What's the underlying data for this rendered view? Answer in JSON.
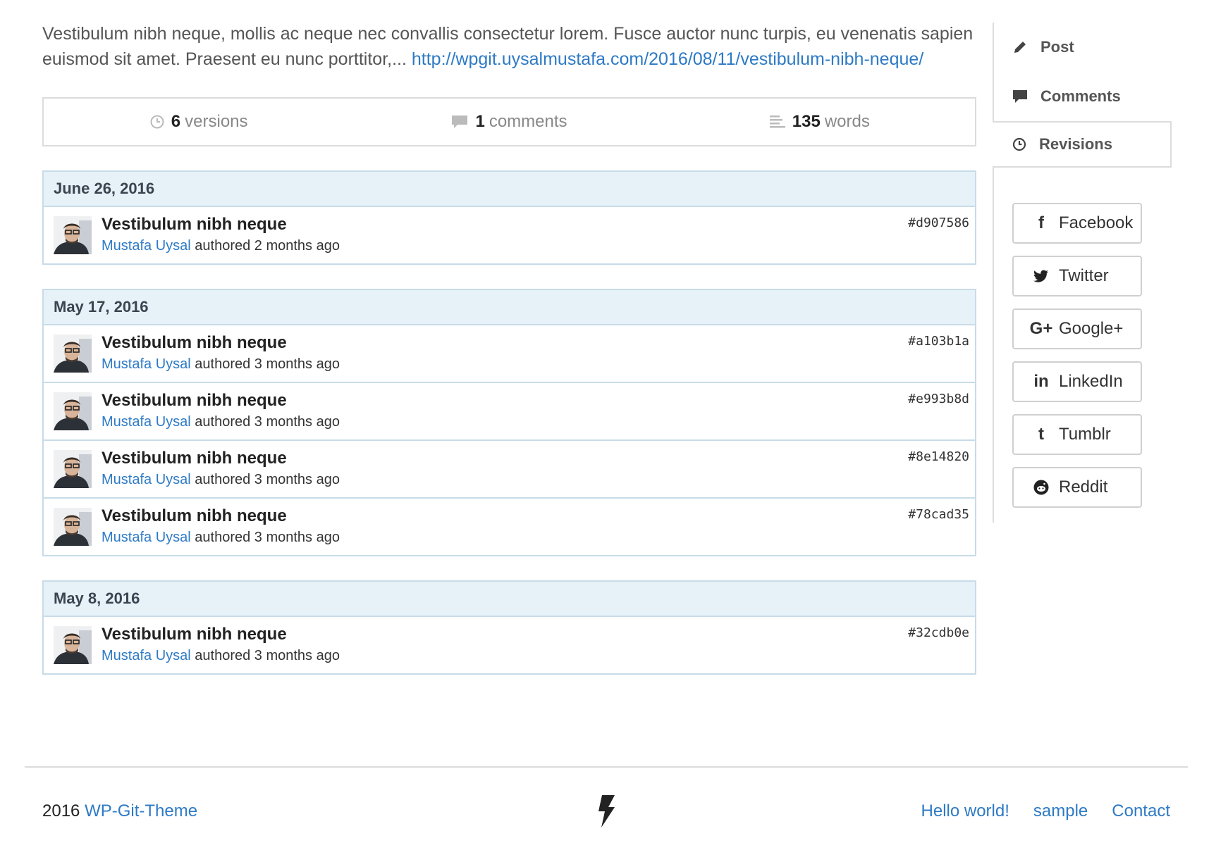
{
  "excerpt": {
    "text": "Vestibulum nibh neque, mollis ac neque nec convallis consectetur lorem. Fusce auctor nunc turpis, eu venenatis sapien euismod sit amet. Praesent eu nunc porttitor,...",
    "link": "http://wpgit.uysalmustafa.com/2016/08/11/vestibulum-nibh-neque/"
  },
  "stats": {
    "versions_count": "6",
    "versions_label": "versions",
    "comments_count": "1",
    "comments_label": "comments",
    "words_count": "135",
    "words_label": "words"
  },
  "groups": [
    {
      "date": "June 26, 2016",
      "commits": [
        {
          "title": "Vestibulum nibh neque",
          "author": "Mustafa Uysal",
          "action": "authored 2 months ago",
          "hash": "#d907586"
        }
      ]
    },
    {
      "date": "May 17, 2016",
      "commits": [
        {
          "title": "Vestibulum nibh neque",
          "author": "Mustafa Uysal",
          "action": "authored 3 months ago",
          "hash": "#a103b1a"
        },
        {
          "title": "Vestibulum nibh neque",
          "author": "Mustafa Uysal",
          "action": "authored 3 months ago",
          "hash": "#e993b8d"
        },
        {
          "title": "Vestibulum nibh neque",
          "author": "Mustafa Uysal",
          "action": "authored 3 months ago",
          "hash": "#8e14820"
        },
        {
          "title": "Vestibulum nibh neque",
          "author": "Mustafa Uysal",
          "action": "authored 3 months ago",
          "hash": "#78cad35"
        }
      ]
    },
    {
      "date": "May 8, 2016",
      "commits": [
        {
          "title": "Vestibulum nibh neque",
          "author": "Mustafa Uysal",
          "action": "authored 3 months ago",
          "hash": "#32cdb0e"
        }
      ]
    }
  ],
  "sidebar": {
    "nav": [
      {
        "label": "Post",
        "icon": "pencil-icon"
      },
      {
        "label": "Comments",
        "icon": "comment-icon"
      },
      {
        "label": "Revisions",
        "icon": "clock-icon",
        "active": true
      }
    ],
    "share": [
      {
        "label": "Facebook",
        "icon": "facebook-icon",
        "glyph": "f"
      },
      {
        "label": "Twitter",
        "icon": "twitter-icon",
        "glyph": ""
      },
      {
        "label": "Google+",
        "icon": "google-plus-icon",
        "glyph": "G+"
      },
      {
        "label": "LinkedIn",
        "icon": "linkedin-icon",
        "glyph": "in"
      },
      {
        "label": "Tumblr",
        "icon": "tumblr-icon",
        "glyph": "t"
      },
      {
        "label": "Reddit",
        "icon": "reddit-icon",
        "glyph": ""
      }
    ]
  },
  "footer": {
    "year": "2016",
    "site_name": "WP-Git-Theme",
    "links": [
      "Hello world!",
      "sample",
      "Contact"
    ]
  }
}
